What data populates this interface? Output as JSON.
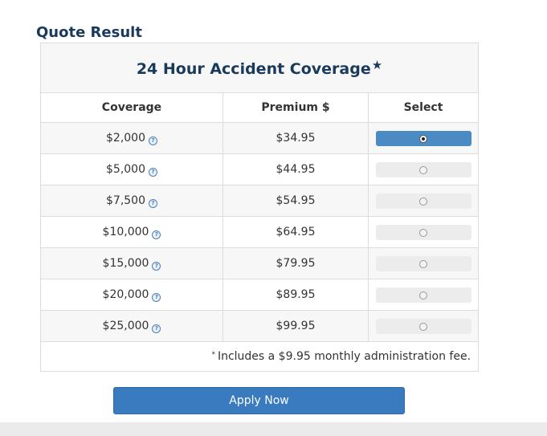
{
  "page": {
    "title": "Quote Result"
  },
  "table": {
    "title": "24 Hour Accident Coverage",
    "title_marker": "★",
    "headers": {
      "coverage": "Coverage",
      "premium": "Premium $",
      "select": "Select"
    },
    "help_icon": "?",
    "rows": [
      {
        "coverage": "$2,000",
        "premium": "$34.95",
        "selected": true
      },
      {
        "coverage": "$5,000",
        "premium": "$44.95",
        "selected": false
      },
      {
        "coverage": "$7,500",
        "premium": "$54.95",
        "selected": false
      },
      {
        "coverage": "$10,000",
        "premium": "$64.95",
        "selected": false
      },
      {
        "coverage": "$15,000",
        "premium": "$79.95",
        "selected": false
      },
      {
        "coverage": "$20,000",
        "premium": "$89.95",
        "selected": false
      },
      {
        "coverage": "$25,000",
        "premium": "$99.95",
        "selected": false
      }
    ],
    "footnote_marker": "*",
    "footnote": "Includes a $9.95 monthly administration fee."
  },
  "apply_button": {
    "label": "Apply Now"
  },
  "colors": {
    "title": "#1a3a5c",
    "selected_button": "#4b8bc4",
    "apply_button": "#3a7bbf",
    "help_icon": "#4a7fb5"
  },
  "icons": {
    "help": "question-circle-icon",
    "radio": "radio-button-icon"
  }
}
